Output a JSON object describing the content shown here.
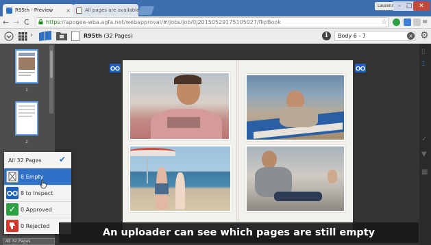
{
  "browser": {
    "tabs": [
      {
        "label": "R95th - Preview",
        "close": "×",
        "active": true
      },
      {
        "label": "All pages are available",
        "close": "×",
        "active": false
      }
    ],
    "user_badge": "Laurens",
    "url": {
      "scheme": "https",
      "rest": "://apogee-wba.agfa.net/webapproval/#/jobs/job/0J20150529175105027/flipBook"
    }
  },
  "toolbar": {
    "job_name": "R95th",
    "page_count": "(32 Pages)",
    "info_glyph": "i",
    "page_selection": "Body 6 - 7",
    "clear_glyph": "×"
  },
  "thumbnails": [
    {
      "number": "1"
    },
    {
      "number": "2"
    }
  ],
  "filter_menu": {
    "items": [
      {
        "label": "All 32 Pages",
        "icon": "check-icon",
        "selected": true
      },
      {
        "label": "8 Empty",
        "icon": "empty-page-icon",
        "highlighted": true
      },
      {
        "label": "8 to Inspect",
        "icon": "glasses-icon"
      },
      {
        "label": "0 Approved",
        "icon": "check-icon"
      },
      {
        "label": "0 Rejected",
        "icon": "thumbs-down-icon"
      }
    ],
    "bottom_select": "All 32 Pages"
  },
  "caption": "An uploader can see which pages are still empty",
  "colors": {
    "accent_blue": "#2f71c6",
    "approved_green": "#2ea043",
    "rejected_red": "#d9362b",
    "browser_blue": "#3d6fb0"
  }
}
